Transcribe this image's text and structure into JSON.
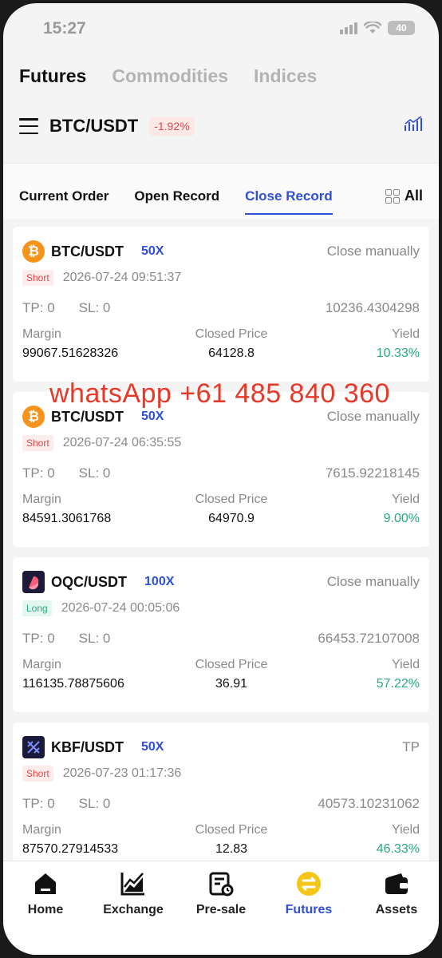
{
  "status_bar": {
    "time": "15:27",
    "battery": "40"
  },
  "top_tabs": [
    {
      "label": "Futures",
      "active": true
    },
    {
      "label": "Commodities",
      "active": false
    },
    {
      "label": "Indices",
      "active": false
    }
  ],
  "pair": {
    "title": "BTC/USDT",
    "change": "-1.92%"
  },
  "sub_tabs": [
    {
      "label": "Current Order",
      "active": false
    },
    {
      "label": "Open Record",
      "active": false
    },
    {
      "label": "Close Record",
      "active": true
    }
  ],
  "all_label": "All",
  "labels": {
    "tp": "TP:",
    "sl": "SL:",
    "margin": "Margin",
    "closed_price": "Closed Price",
    "yield": "Yield"
  },
  "records": [
    {
      "pair": "BTC/USDT",
      "leverage": "50X",
      "status": "Close manually",
      "side": "Short",
      "date": "2026-07-24 09:51:37",
      "tp": "0",
      "sl": "0",
      "pnl": "10236.4304298",
      "margin": "99067.51628326",
      "closed_price": "64128.8",
      "yield": "10.33%"
    },
    {
      "pair": "BTC/USDT",
      "leverage": "50X",
      "status": "Close manually",
      "side": "Short",
      "date": "2026-07-24 06:35:55",
      "tp": "0",
      "sl": "0",
      "pnl": "7615.92218145",
      "margin": "84591.3061768",
      "closed_price": "64970.9",
      "yield": "9.00%"
    },
    {
      "pair": "OQC/USDT",
      "leverage": "100X",
      "status": "Close manually",
      "side": "Long",
      "date": "2026-07-24 00:05:06",
      "tp": "0",
      "sl": "0",
      "pnl": "66453.72107008",
      "margin": "116135.78875606",
      "closed_price": "36.91",
      "yield": "57.22%"
    },
    {
      "pair": "KBF/USDT",
      "leverage": "50X",
      "status": "TP",
      "side": "Short",
      "date": "2026-07-23 01:17:36",
      "tp": "0",
      "sl": "0",
      "pnl": "40573.10231062",
      "margin": "87570.27914533",
      "closed_price": "12.83",
      "yield": "46.33%"
    }
  ],
  "watermark": "whatsApp +61 485 840 360",
  "nav": [
    {
      "label": "Home",
      "icon": "home-icon"
    },
    {
      "label": "Exchange",
      "icon": "exchange-chart-icon"
    },
    {
      "label": "Pre-sale",
      "icon": "presale-receipt-icon"
    },
    {
      "label": "Futures",
      "icon": "futures-icon",
      "active": true
    },
    {
      "label": "Assets",
      "icon": "wallet-icon"
    }
  ],
  "colors": {
    "accent": "#2f4fd6",
    "up": "#2aaa7e",
    "down": "#e04848",
    "btc": "#f7931a"
  }
}
